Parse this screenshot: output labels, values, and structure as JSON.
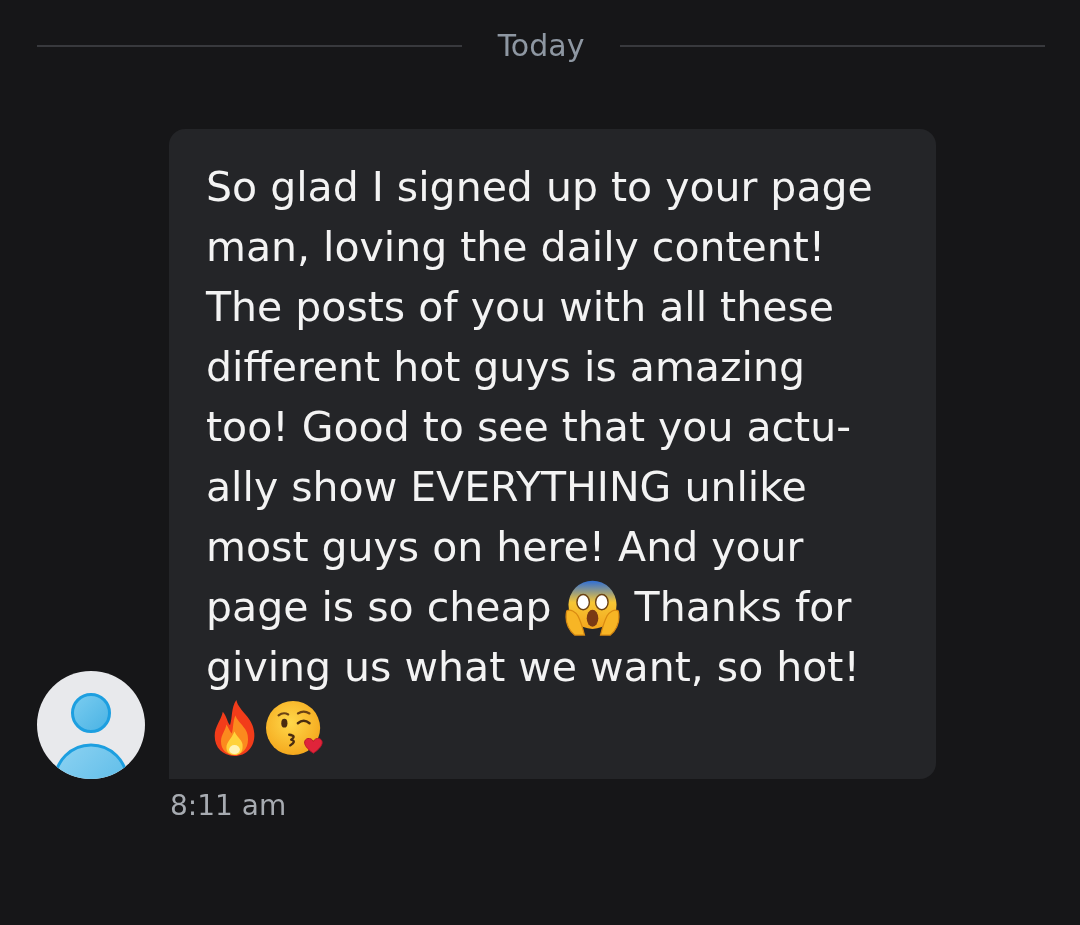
{
  "date_divider": {
    "label": "Today"
  },
  "message": {
    "parts": [
      {
        "kind": "text",
        "text": "So glad I signed up to your page man, loving the daily content! The posts of you with all these different hot guys is amazing too! Good to see that you actu-ally show EVERYTHING unlike most guys on here! And your"
      },
      {
        "kind": "text",
        "text": "page is so cheap"
      },
      {
        "kind": "scream"
      },
      {
        "kind": "text",
        "text": "Thanks for"
      },
      {
        "kind": "text",
        "text": "giving us what we want, so hot!"
      },
      {
        "kind": "fire"
      },
      {
        "kind": "kiss"
      }
    ],
    "time": "8:11 am"
  }
}
